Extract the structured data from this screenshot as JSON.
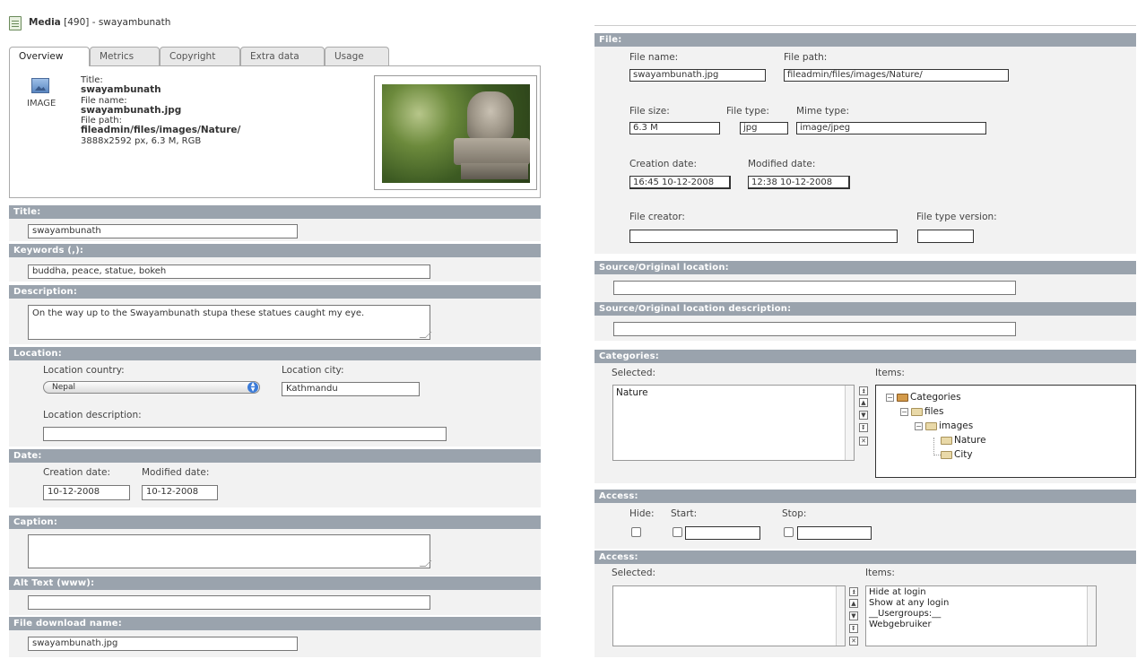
{
  "left": {
    "header": {
      "module": "Media",
      "id": "[490]",
      "record": "- swayambunath"
    },
    "tabs": [
      {
        "label": "Overview"
      },
      {
        "label": "Metrics"
      },
      {
        "label": "Copyright"
      },
      {
        "label": "Extra data"
      },
      {
        "label": "Usage"
      }
    ],
    "overview": {
      "type_label": "IMAGE",
      "title_caption": "Title:",
      "title_value": "swayambunath",
      "filename_caption": "File name:",
      "filename_value": "swayambunath.jpg",
      "filepath_caption": "File path:",
      "filepath_value": "fileadmin/files/images/Nature/",
      "dimensions": "3888x2592 px, 6.3 M, RGB"
    },
    "title": {
      "label": "Title:",
      "value": "swayambunath"
    },
    "keywords": {
      "label": "Keywords (,):",
      "value": "buddha, peace, statue, bokeh"
    },
    "description": {
      "label": "Description:",
      "value": "On the way up to the Swayambunath stupa these statues caught my eye."
    },
    "location": {
      "label": "Location:",
      "country_label": "Location country:",
      "country_value": "Nepal",
      "city_label": "Location city:",
      "city_value": "Kathmandu",
      "desc_label": "Location description:",
      "desc_value": ""
    },
    "date": {
      "label": "Date:",
      "creation_label": "Creation date:",
      "creation_value": "10-12-2008",
      "modified_label": "Modified date:",
      "modified_value": "10-12-2008"
    },
    "caption": {
      "label": "Caption:",
      "value": ""
    },
    "alt_text": {
      "label": "Alt Text (www):",
      "value": ""
    },
    "download_name": {
      "label": "File download name:",
      "value": "swayambunath.jpg"
    }
  },
  "right": {
    "file": {
      "label": "File:",
      "name_label": "File name:",
      "name_value": "swayambunath.jpg",
      "path_label": "File path:",
      "path_value": "fileadmin/files/images/Nature/",
      "size_label": "File size:",
      "size_value": "6.3 M",
      "type_label": "File type:",
      "type_value": "jpg",
      "mime_label": "Mime type:",
      "mime_value": "image/jpeg",
      "creation_label": "Creation date:",
      "creation_value": "16:45 10-12-2008",
      "modified_label": "Modified date:",
      "modified_value": "12:38 10-12-2008",
      "creator_label": "File creator:",
      "creator_value": "",
      "version_label": "File type version:",
      "version_value": ""
    },
    "source_location": {
      "label": "Source/Original location:",
      "value": ""
    },
    "source_description": {
      "label": "Source/Original location description:",
      "value": ""
    },
    "categories": {
      "label": "Categories:",
      "selected_label": "Selected:",
      "items_label": "Items:",
      "selected": [
        "Nature"
      ],
      "tree": [
        "Categories",
        "files",
        "images",
        "Nature",
        "City"
      ]
    },
    "access1": {
      "label": "Access:",
      "hide_label": "Hide:",
      "start_label": "Start:",
      "stop_label": "Stop:"
    },
    "access2": {
      "label": "Access:",
      "selected_label": "Selected:",
      "items_label": "Items:",
      "items": [
        "Hide at login",
        "Show at any login",
        "__Usergroups:__",
        "Webgebruiker"
      ]
    }
  }
}
